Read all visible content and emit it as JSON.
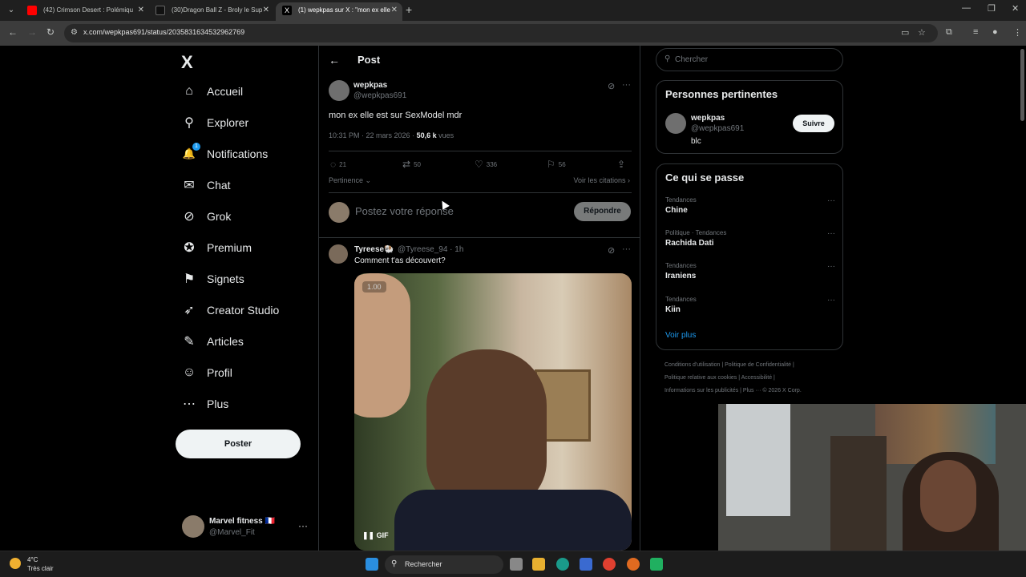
{
  "browser": {
    "tabs": [
      {
        "title": "(42) Crimson Desert : Polémiqu",
        "favicon_color": "#ff0000"
      },
      {
        "title": "(30)Dragon Ball Z - Broly le Sup",
        "favicon_color": "#111111"
      },
      {
        "title": "(1) wepkpas sur X : \"mon ex elle",
        "favicon_color": "#000000"
      }
    ],
    "url": "x.com/wepkpas691/status/2035831634532962769"
  },
  "sidebar": {
    "logo": "X",
    "items": [
      {
        "label": "Accueil",
        "icon": "⌂"
      },
      {
        "label": "Explorer",
        "icon": "⚲"
      },
      {
        "label": "Notifications",
        "icon": "🔔",
        "badge": "1"
      },
      {
        "label": "Chat",
        "icon": "✉"
      },
      {
        "label": "Grok",
        "icon": "⊘"
      },
      {
        "label": "Premium",
        "icon": "✪"
      },
      {
        "label": "Signets",
        "icon": "⚑"
      },
      {
        "label": "Creator Studio",
        "icon": "➶"
      },
      {
        "label": "Articles",
        "icon": "✎"
      },
      {
        "label": "Profil",
        "icon": "☺"
      },
      {
        "label": "Plus",
        "icon": "⋯"
      }
    ],
    "post_button": "Poster",
    "account": {
      "name": "Marvel fitness 🇫🇷",
      "handle": "@Marvel_Fit"
    }
  },
  "post": {
    "header_title": "Post",
    "author_name": "wepkpas",
    "author_handle": "@wepkpas691",
    "text": "mon ex elle est sur SexModel mdr",
    "time": "10:31 PM · 22 mars 2026 · ",
    "views_count": "50,6 k",
    "views_label": " vues",
    "actions": {
      "replies": "21",
      "reposts": "50",
      "likes": "336",
      "bookmarks": "56"
    },
    "sort_label": "Pertinence",
    "quotes_label": "Voir les citations",
    "reply_placeholder": "Postez votre réponse",
    "reply_button": "Répondre"
  },
  "reply": {
    "name": "Tyreese🐏",
    "handle": "@Tyreese_94 · 1h",
    "text": "Comment t'as découvert?",
    "media_timestamp": "1.00",
    "media_label": "GIF"
  },
  "right": {
    "search_placeholder": "Chercher",
    "relevant_title": "Personnes pertinentes",
    "relevant_person": {
      "name": "wepkpas",
      "handle": "@wepkpas691",
      "bio": "blc",
      "follow": "Suivre"
    },
    "trends_title": "Ce qui se passe",
    "trends": [
      {
        "category": "Tendances",
        "name": "Chine"
      },
      {
        "category": "Politique · Tendances",
        "name": "Rachida Dati"
      },
      {
        "category": "Tendances",
        "name": "Iraniens"
      },
      {
        "category": "Tendances",
        "name": "Kiin"
      }
    ],
    "show_more": "Voir plus",
    "footer_lines": [
      "Conditions d'utilisation  |  Politique de Confidentialité  |",
      "Politique relative aux cookies  |  Accessibilité  |",
      "Informations sur les publicités  |  Plus ···  © 2026 X Corp."
    ]
  },
  "taskbar": {
    "temperature": "4°C",
    "condition": "Très clair",
    "search": "Rechercher"
  }
}
